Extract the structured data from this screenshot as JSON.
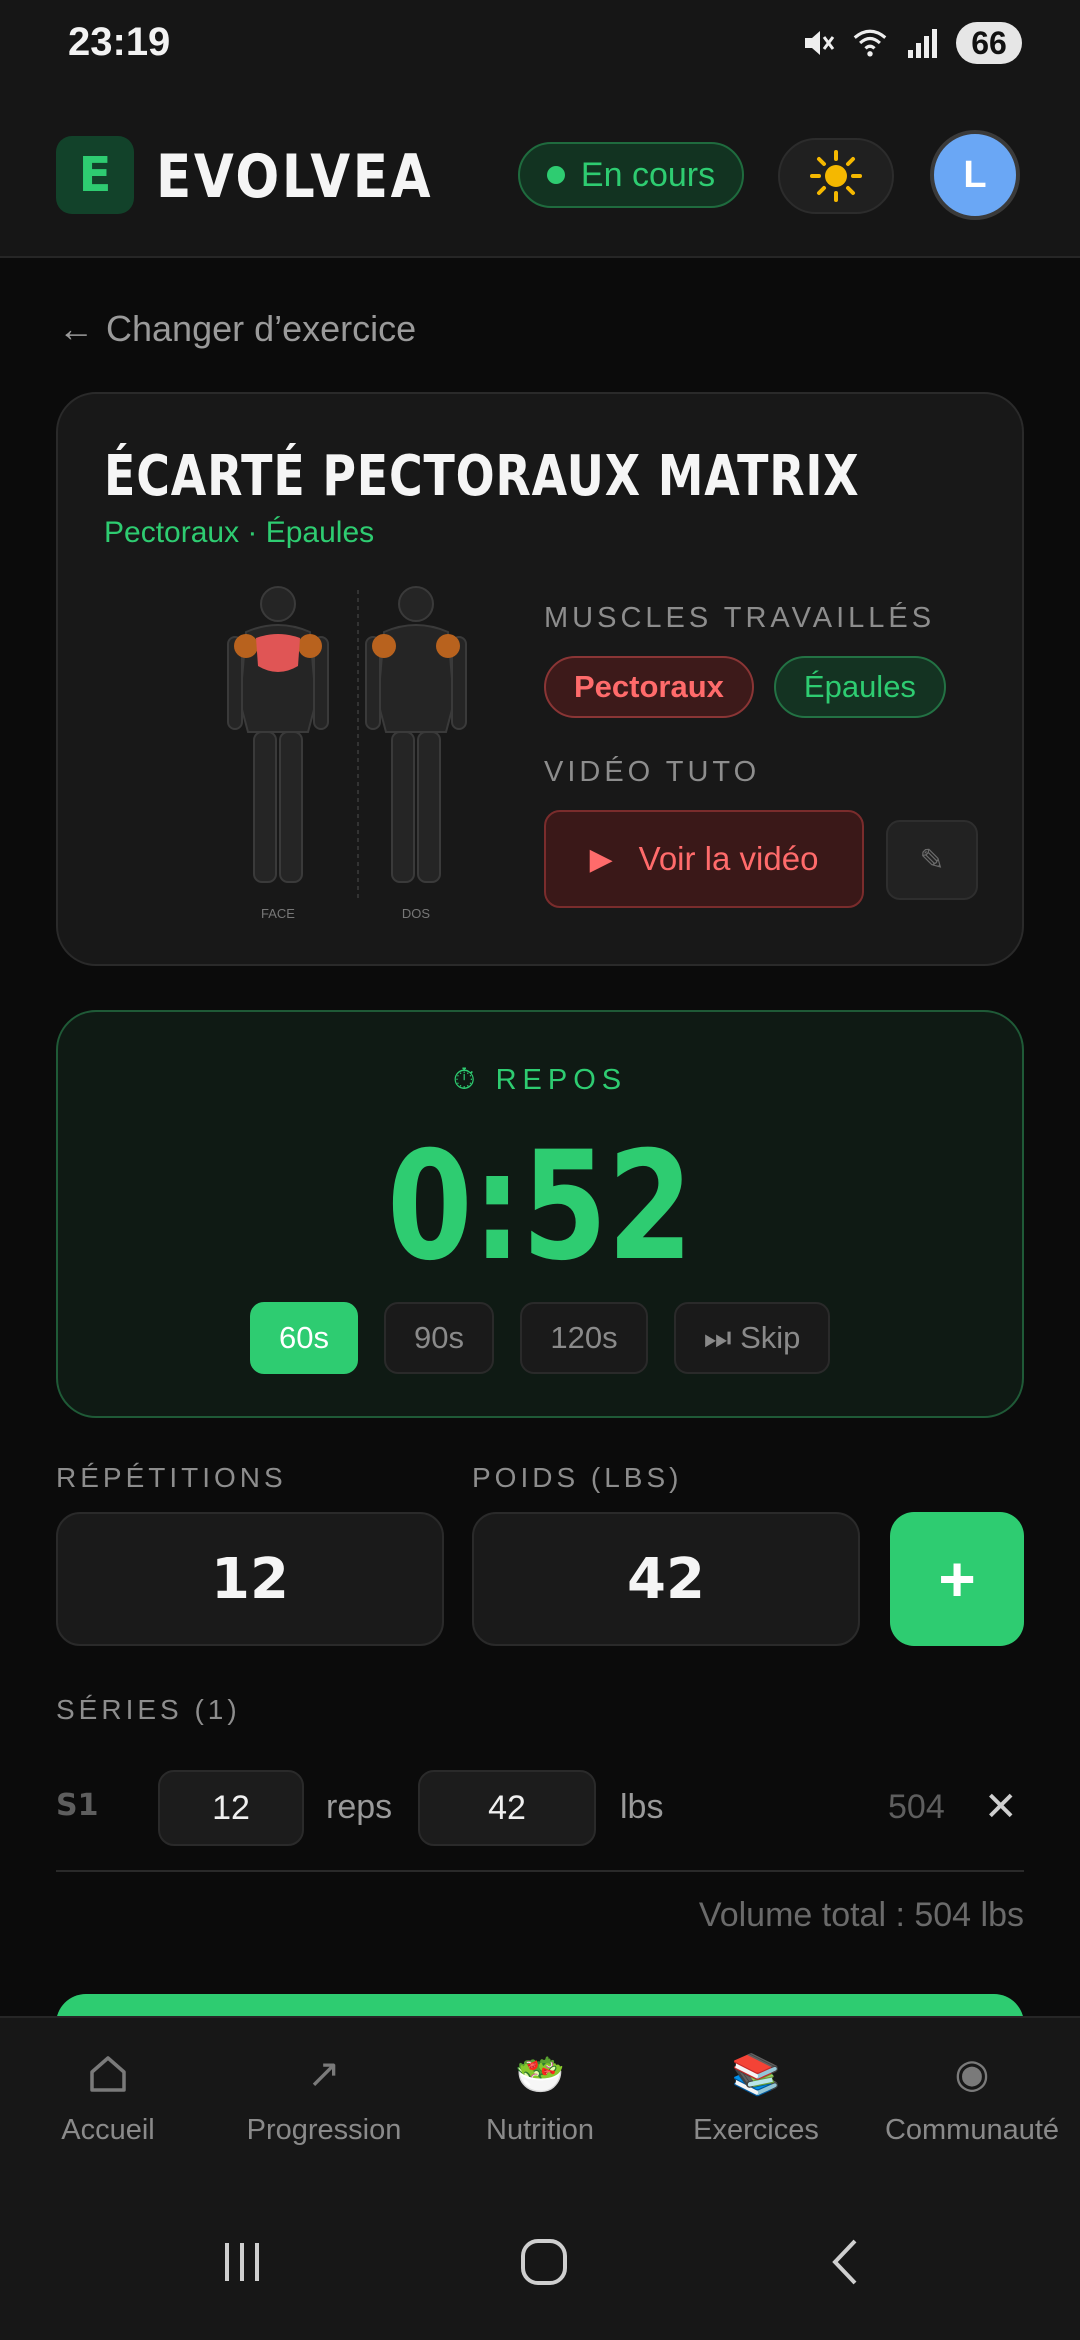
{
  "status_bar": {
    "time": "23:19",
    "battery": "66",
    "icons": [
      "mute-icon",
      "wifi-icon",
      "signal-icon"
    ]
  },
  "header": {
    "logo_letter": "E",
    "brand": "EVOLVEA",
    "status": "En cours",
    "theme_icon": "sun-icon",
    "avatar_initial": "L"
  },
  "back_link": {
    "arrow": "←",
    "label": "Changer d’exercice"
  },
  "exercise": {
    "title": "ÉCARTÉ PECTORAUX MATRIX",
    "subtitle": "Pectoraux · Épaules",
    "bodymap": {
      "front_label": "FACE",
      "back_label": "DOS"
    },
    "muscles_label": "MUSCLES TRAVAILLÉS",
    "muscles": [
      "Pectoraux",
      "Épaules"
    ],
    "video_label": "VIDÉO TUTO",
    "video_play": "▶",
    "video_button": "Voir la vidéo",
    "edit_icon": "✎"
  },
  "rest": {
    "label": "⏱ REPOS",
    "time": "0:52",
    "options": [
      "60s",
      "90s",
      "120s"
    ],
    "active_option": "60s",
    "skip": "⏭ Skip"
  },
  "inputs": {
    "reps_label": "RÉPÉTITIONS",
    "reps_value": "12",
    "weight_label": "POIDS (LBS)",
    "weight_value": "42",
    "add": "+"
  },
  "series": {
    "label": "SÉRIES (1)",
    "rows": [
      {
        "index": "S1",
        "reps": "12",
        "reps_unit": "reps",
        "weight": "42",
        "weight_unit": "lbs",
        "volume": "504",
        "delete": "✕"
      }
    ],
    "volume_total": "Volume total : 504 lbs"
  },
  "bottom_nav": {
    "items": [
      {
        "label": "Accueil",
        "icon": "⌂"
      },
      {
        "label": "Progression",
        "icon": "↗"
      },
      {
        "label": "Nutrition",
        "icon": "🥗"
      },
      {
        "label": "Exercices",
        "icon": "📚"
      },
      {
        "label": "Communauté",
        "icon": "◉"
      }
    ]
  },
  "colors": {
    "accent": "#2ecc71",
    "danger": "#ff6b6b",
    "background": "#0b0b0b",
    "avatar": "#6aa7f5"
  }
}
